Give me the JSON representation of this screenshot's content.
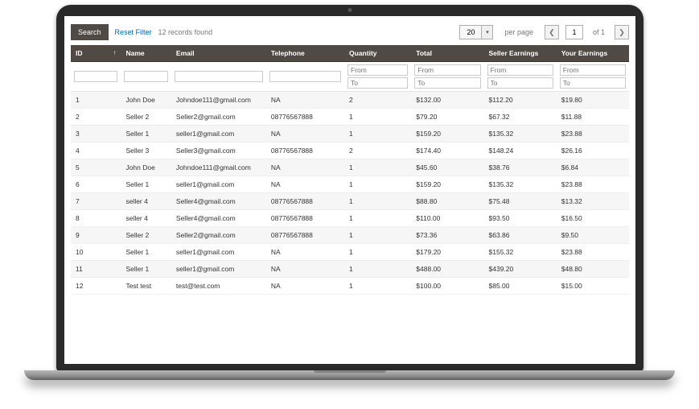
{
  "toolbar": {
    "search_label": "Search",
    "reset_label": "Reset Filter",
    "records_found": "12 records found",
    "per_page_value": "20",
    "per_page_label": "per page",
    "page_value": "1",
    "of_label": "of 1"
  },
  "columns": {
    "id": "ID",
    "name": "Name",
    "email": "Email",
    "telephone": "Telephone",
    "quantity": "Quantity",
    "total": "Total",
    "seller_earnings": "Seller Earnings",
    "your_earnings": "Your Earnings"
  },
  "filters": {
    "from": "From",
    "to": "To"
  },
  "rows": [
    {
      "id": "1",
      "name": "John Doe",
      "email": "Johndoe111@gmail.com",
      "tel": "NA",
      "qty": "2",
      "total": "$132.00",
      "se": "$112.20",
      "ye": "$19.80"
    },
    {
      "id": "2",
      "name": "Seller 2",
      "email": "Seller2@gmail.com",
      "tel": "08776567888",
      "qty": "1",
      "total": "$79.20",
      "se": "$67.32",
      "ye": "$11.88"
    },
    {
      "id": "3",
      "name": "Seller 1",
      "email": "seller1@gmail.com",
      "tel": "NA",
      "qty": "1",
      "total": "$159.20",
      "se": "$135.32",
      "ye": "$23.88"
    },
    {
      "id": "4",
      "name": "Seller 3",
      "email": "Seller3@gmail.com",
      "tel": "08776567888",
      "qty": "2",
      "total": "$174.40",
      "se": "$148.24",
      "ye": "$26.16"
    },
    {
      "id": "5",
      "name": "John Doe",
      "email": "Johndoe111@gmail.com",
      "tel": "NA",
      "qty": "1",
      "total": "$45.60",
      "se": "$38.76",
      "ye": "$6.84"
    },
    {
      "id": "6",
      "name": "Seller 1",
      "email": "seller1@gmail.com",
      "tel": "NA",
      "qty": "1",
      "total": "$159.20",
      "se": "$135.32",
      "ye": "$23.88"
    },
    {
      "id": "7",
      "name": "seller 4",
      "email": "Seller4@gmail.com",
      "tel": "08776567888",
      "qty": "1",
      "total": "$88.80",
      "se": "$75.48",
      "ye": "$13.32"
    },
    {
      "id": "8",
      "name": "seller 4",
      "email": "Seller4@gmail.com",
      "tel": "08776567888",
      "qty": "1",
      "total": "$110.00",
      "se": "$93.50",
      "ye": "$16.50"
    },
    {
      "id": "9",
      "name": "Seller 2",
      "email": "Seller2@gmail.com",
      "tel": "08776567888",
      "qty": "1",
      "total": "$73.36",
      "se": "$63.86",
      "ye": "$9.50"
    },
    {
      "id": "10",
      "name": "Seller 1",
      "email": "seller1@gmail.com",
      "tel": "NA",
      "qty": "1",
      "total": "$179.20",
      "se": "$155.32",
      "ye": "$23.88"
    },
    {
      "id": "11",
      "name": "Seller 1",
      "email": "seller1@gmail.com",
      "tel": "NA",
      "qty": "1",
      "total": "$488.00",
      "se": "$439.20",
      "ye": "$48.80"
    },
    {
      "id": "12",
      "name": "Test test",
      "email": "test@test.com",
      "tel": "NA",
      "qty": "1",
      "total": "$100.00",
      "se": "$85.00",
      "ye": "$15.00"
    }
  ]
}
